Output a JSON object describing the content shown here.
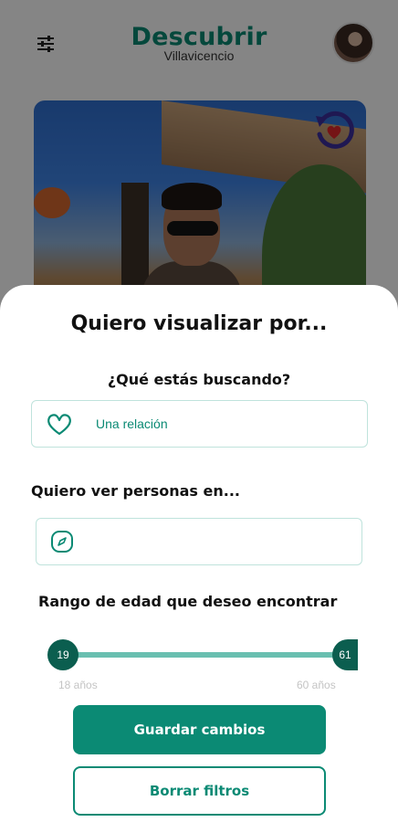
{
  "header": {
    "title": "Descubrir",
    "subtitle": "Villavicencio",
    "filter_icon": "sliders-icon",
    "avatar_icon": "profile-avatar"
  },
  "card": {
    "undo_icon": "undo-heart-icon"
  },
  "sheet": {
    "title": "Quiero visualizar por...",
    "looking_for": {
      "label": "¿Qué estás buscando?",
      "value": "Una relación",
      "icon": "heart-icon"
    },
    "location": {
      "label": "Quiero ver personas en...",
      "value": "",
      "icon": "compass-icon"
    },
    "age_range": {
      "label": "Rango de edad que deseo encontrar",
      "min_value": "19",
      "max_value": "61",
      "min_caption": "18 años",
      "max_caption": "60 años"
    },
    "save_button": "Guardar cambios",
    "clear_button": "Borrar filtros"
  },
  "colors": {
    "brand": "#0b8a74",
    "slider_track": "#69bfb0",
    "knob": "#0b5e4f"
  }
}
